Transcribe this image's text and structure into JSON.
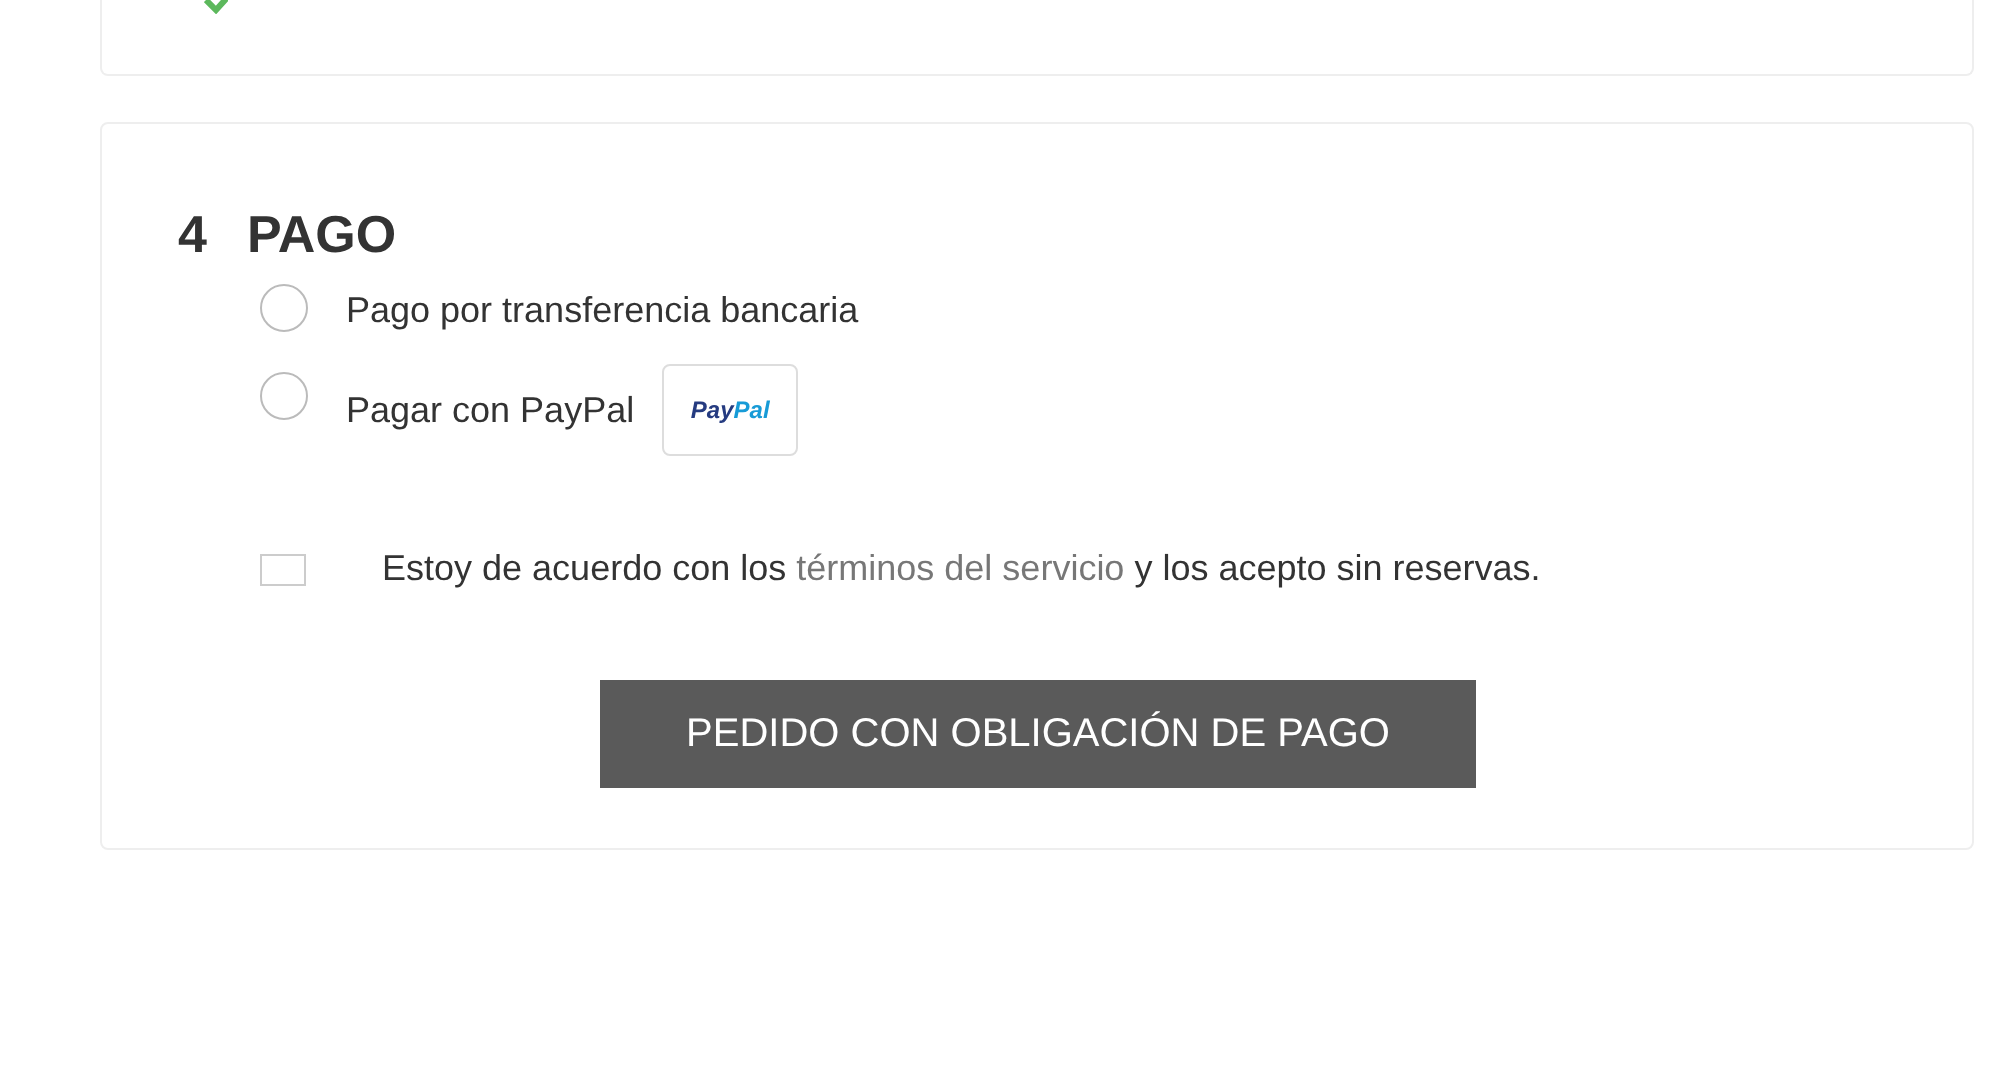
{
  "previous_step": {
    "completed": true
  },
  "payment": {
    "number": "4",
    "title": "PAGO",
    "options": [
      {
        "label": "Pago por transferencia bancaria",
        "selected": false,
        "kind": "plain"
      },
      {
        "label": "Pagar con PayPal",
        "selected": false,
        "kind": "paypal",
        "logo": [
          "Pay",
          "Pal"
        ]
      }
    ],
    "terms": {
      "checked": false,
      "before": "Estoy de acuerdo con los",
      "link": "términos del servicio",
      "after": "y los acepto sin reservas."
    },
    "submit": "PEDIDO CON OBLIGACIÓN DE PAGO"
  }
}
